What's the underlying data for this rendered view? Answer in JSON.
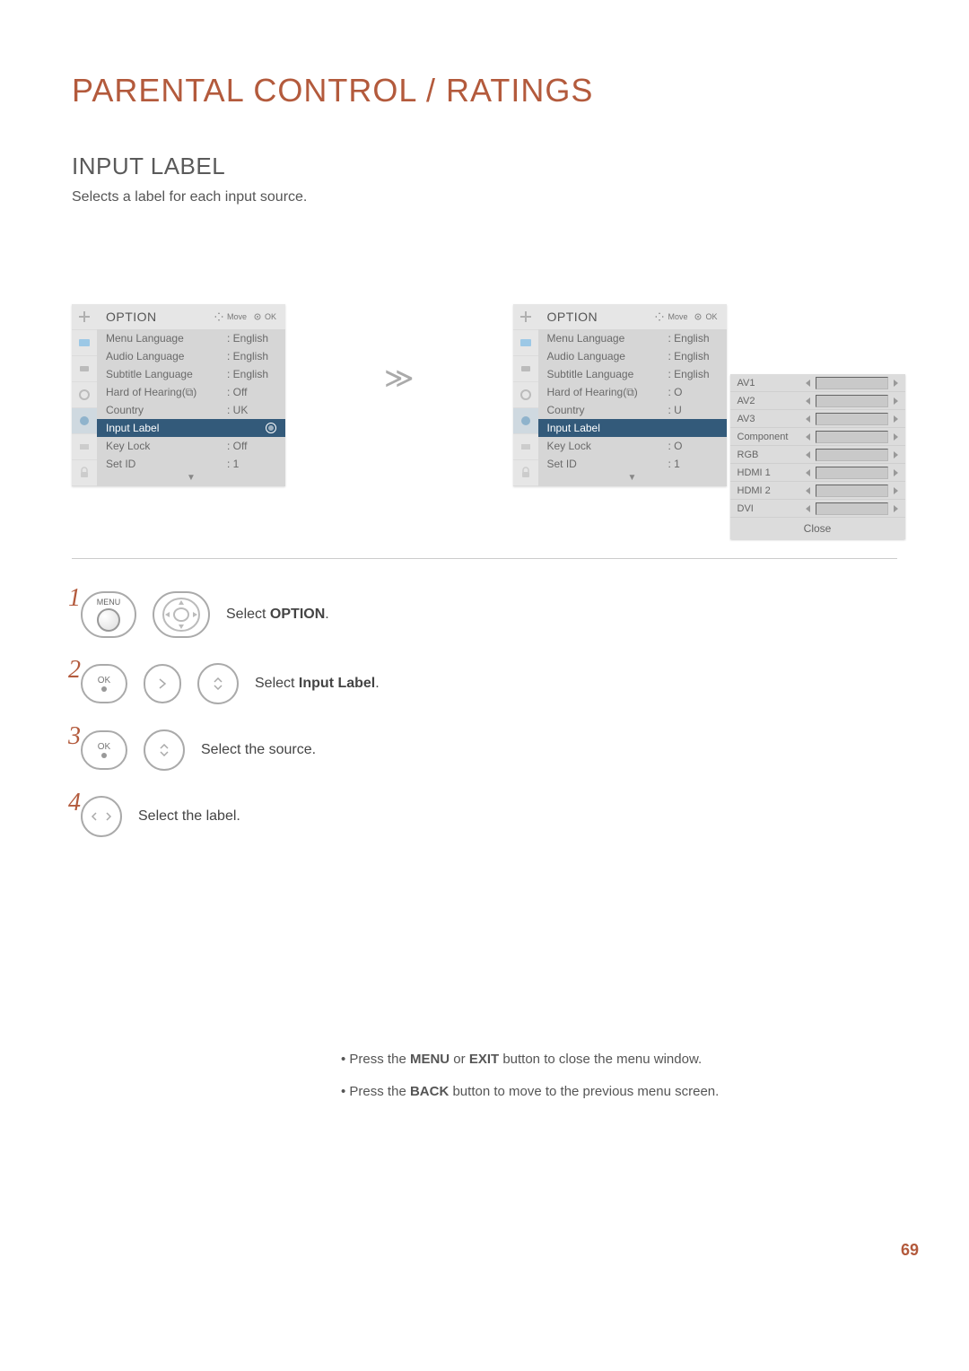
{
  "page": {
    "title": "PARENTAL CONTROL / RATINGS",
    "subtitle": "INPUT LABEL",
    "desc": "Selects a label for each input source.",
    "number": "69"
  },
  "osd": {
    "header": "OPTION",
    "hint_move": "Move",
    "hint_ok": "OK",
    "rows": [
      {
        "label": "Menu Language",
        "value": ": English"
      },
      {
        "label": "Audio Language",
        "value": ": English"
      },
      {
        "label": "Subtitle Language",
        "value": ": English"
      },
      {
        "label": "Hard of Hearing(⧉)",
        "value": ": Off"
      },
      {
        "label": "Country",
        "value": ": UK"
      },
      {
        "label": "Input Label",
        "value": "",
        "selected": true
      },
      {
        "label": "Key Lock",
        "value": ": Off"
      },
      {
        "label": "Set ID",
        "value": ": 1"
      }
    ]
  },
  "osd2": {
    "rows": [
      {
        "label": "Menu Language",
        "value": ": English"
      },
      {
        "label": "Audio Language",
        "value": ": English"
      },
      {
        "label": "Subtitle Language",
        "value": ": English"
      },
      {
        "label": "Hard of Hearing(⧉)",
        "value": ": O"
      },
      {
        "label": "Country",
        "value": ": U"
      },
      {
        "label": "Input Label",
        "value": "",
        "selected": true
      },
      {
        "label": "Key Lock",
        "value": ": O"
      },
      {
        "label": "Set ID",
        "value": ": 1"
      }
    ]
  },
  "popup": {
    "items": [
      "AV1",
      "AV2",
      "AV3",
      "Component",
      "RGB",
      "HDMI 1",
      "HDMI 2",
      "DVI"
    ],
    "close": "Close"
  },
  "steps": [
    {
      "num": "1",
      "btn": "MENU",
      "pre": "Select ",
      "bold": "OPTION",
      "post": "."
    },
    {
      "num": "2",
      "btn": "OK",
      "pre": "Select ",
      "bold": "Input Label",
      "post": "."
    },
    {
      "num": "3",
      "btn": "OK",
      "pre": "Select the source.",
      "bold": "",
      "post": ""
    },
    {
      "num": "4",
      "btn": "",
      "pre": "Select the label.",
      "bold": "",
      "post": ""
    }
  ],
  "notes": {
    "l1_pre": "Press the ",
    "l1_b1": "MENU",
    "l1_mid": " or ",
    "l1_b2": "EXIT",
    "l1_post": " button to close the menu window.",
    "l2_pre": "Press the ",
    "l2_b1": "BACK",
    "l2_post": " button to move to the previous menu screen."
  }
}
